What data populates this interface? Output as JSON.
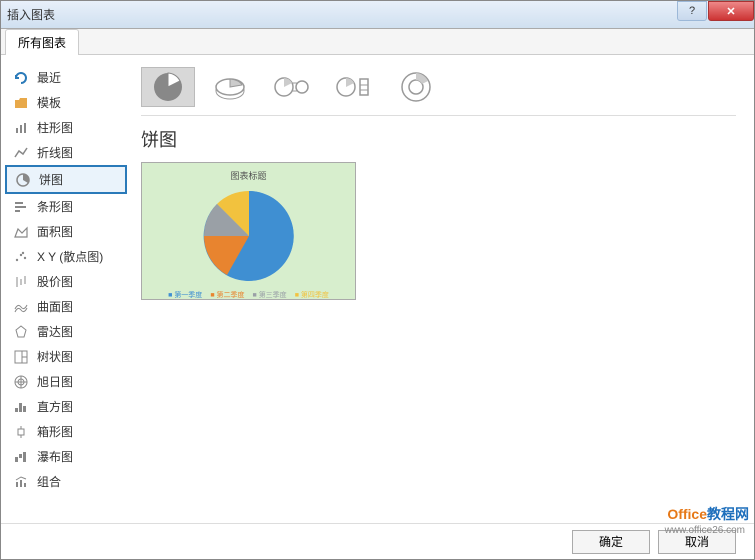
{
  "titlebar": {
    "title": "插入图表"
  },
  "tabs": {
    "all": "所有图表"
  },
  "sidebar": {
    "items": [
      {
        "label": "最近"
      },
      {
        "label": "模板"
      },
      {
        "label": "柱形图"
      },
      {
        "label": "折线图"
      },
      {
        "label": "饼图"
      },
      {
        "label": "条形图"
      },
      {
        "label": "面积图"
      },
      {
        "label": "X Y (散点图)"
      },
      {
        "label": "股价图"
      },
      {
        "label": "曲面图"
      },
      {
        "label": "雷达图"
      },
      {
        "label": "树状图"
      },
      {
        "label": "旭日图"
      },
      {
        "label": "直方图"
      },
      {
        "label": "箱形图"
      },
      {
        "label": "瀑布图"
      },
      {
        "label": "组合"
      }
    ]
  },
  "main": {
    "subtype_title": "饼图",
    "preview": {
      "title": "图表标题",
      "legend": [
        "第一季度",
        "第二季度",
        "第三季度",
        "第四季度"
      ]
    }
  },
  "footer": {
    "ok": "确定",
    "cancel": "取消"
  },
  "watermark": {
    "brand1": "Office",
    "brand2": "教程网",
    "url": "www.office26.com"
  },
  "chart_data": {
    "type": "pie",
    "title": "图表标题",
    "categories": [
      "第一季度",
      "第二季度",
      "第三季度",
      "第四季度"
    ],
    "values": [
      50,
      25,
      13,
      12
    ],
    "colors": [
      "#3f8fd2",
      "#e8842f",
      "#9aa0a6",
      "#f2c23e"
    ]
  }
}
